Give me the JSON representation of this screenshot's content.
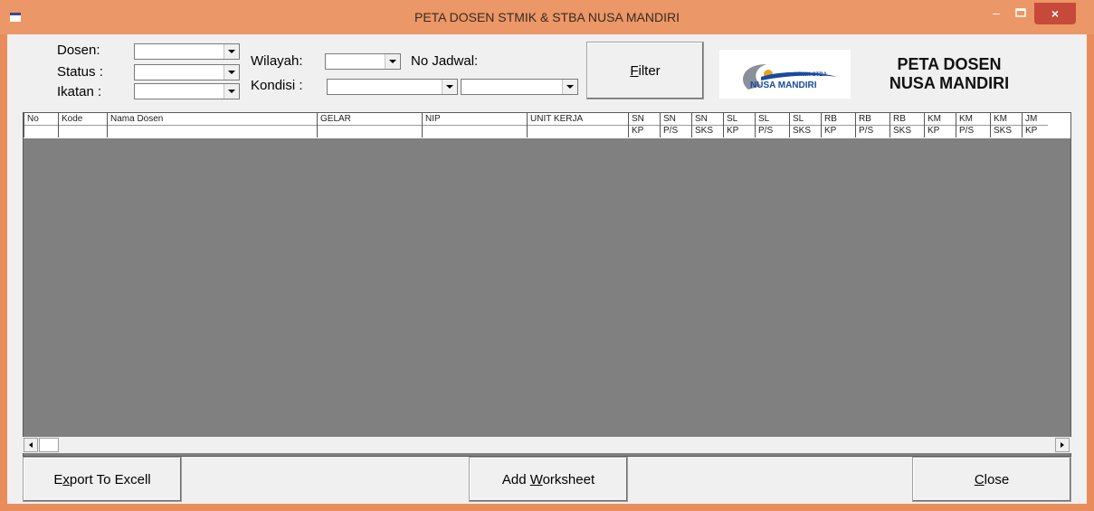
{
  "window": {
    "title": "PETA DOSEN STMIK & STBA NUSA MANDIRI",
    "min_symbol": "–",
    "close_symbol": "×"
  },
  "filters": {
    "dosen_label": "Dosen:",
    "status_label": "Status :",
    "ikatan_label": "Ikatan :",
    "wilayah_label": "Wilayah:",
    "kondisi_label": "Kondisi :",
    "no_jadwal_label": "No Jadwal:",
    "filter_button": {
      "accel": "F",
      "rest": "ilter"
    }
  },
  "brand": {
    "logo_small_text": "STMIK-STBA",
    "logo_main_text": "NUSA MANDIRI",
    "title_line1": "PETA DOSEN",
    "title_line2": "NUSA MANDIRI"
  },
  "grid": {
    "columns": [
      {
        "top": "No",
        "bottom": ""
      },
      {
        "top": "Kode",
        "bottom": ""
      },
      {
        "top": "Nama Dosen",
        "bottom": ""
      },
      {
        "top": "GELAR",
        "bottom": ""
      },
      {
        "top": "NIP",
        "bottom": ""
      },
      {
        "top": "UNIT KERJA",
        "bottom": ""
      },
      {
        "top": "SN",
        "bottom": "KP"
      },
      {
        "top": "SN",
        "bottom": "P/S"
      },
      {
        "top": "SN",
        "bottom": "SKS"
      },
      {
        "top": "SL",
        "bottom": "KP"
      },
      {
        "top": "SL",
        "bottom": "P/S"
      },
      {
        "top": "SL",
        "bottom": "SKS"
      },
      {
        "top": "RB",
        "bottom": "KP"
      },
      {
        "top": "RB",
        "bottom": "P/S"
      },
      {
        "top": "RB",
        "bottom": "SKS"
      },
      {
        "top": "KM",
        "bottom": "KP"
      },
      {
        "top": "KM",
        "bottom": "P/S"
      },
      {
        "top": "KM",
        "bottom": "SKS"
      },
      {
        "top": "JM",
        "bottom": "KP"
      }
    ]
  },
  "actions": {
    "export": {
      "pre": "E",
      "accel": "x",
      "rest": "port To Excell"
    },
    "add_worksheet": {
      "pre": "Add ",
      "accel": "W",
      "rest": "orksheet"
    },
    "close": {
      "pre": "",
      "accel": "C",
      "rest": "lose"
    }
  }
}
